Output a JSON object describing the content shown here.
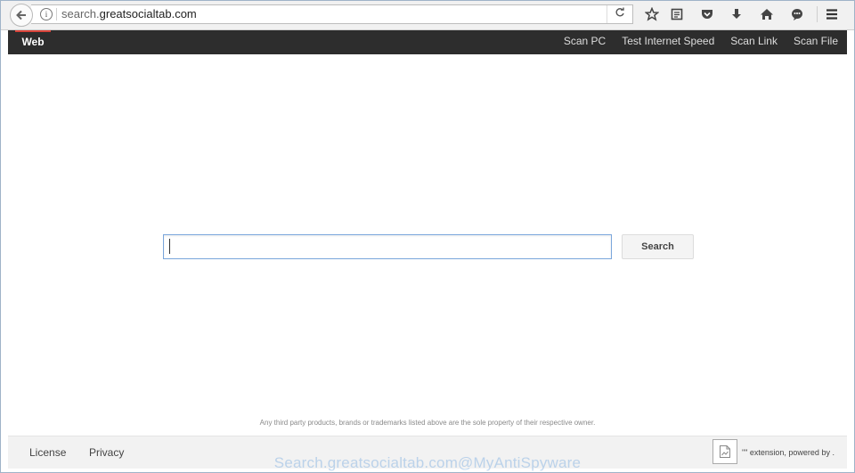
{
  "browser": {
    "url_prefix": "search.",
    "url_domain": "greatsocialtab.com",
    "back_icon": "arrow-left",
    "info_icon": "i",
    "reload_icon": "reload"
  },
  "toolbar_icons": [
    "star-icon",
    "reading-list-icon",
    "pocket-icon",
    "download-icon",
    "home-icon",
    "chat-icon",
    "menu-icon"
  ],
  "header": {
    "tab_web": "Web",
    "nav": [
      "Scan PC",
      "Test Internet Speed",
      "Scan Link",
      "Scan File"
    ]
  },
  "search": {
    "input_value": "",
    "button_label": "Search"
  },
  "disclaimer": "Any third party products, brands or trademarks listed above are the sole property of their respective owner.",
  "footer": {
    "license": "License",
    "privacy": "Privacy",
    "extension_text": "\"\" extension, powered by ."
  },
  "watermark": "Search.greatsocialtab.com@MyAntiSpyware",
  "colors": {
    "header_bg": "#2d2d2d",
    "active_tab_accent": "#d9443a",
    "input_border": "#7aa6dc"
  }
}
